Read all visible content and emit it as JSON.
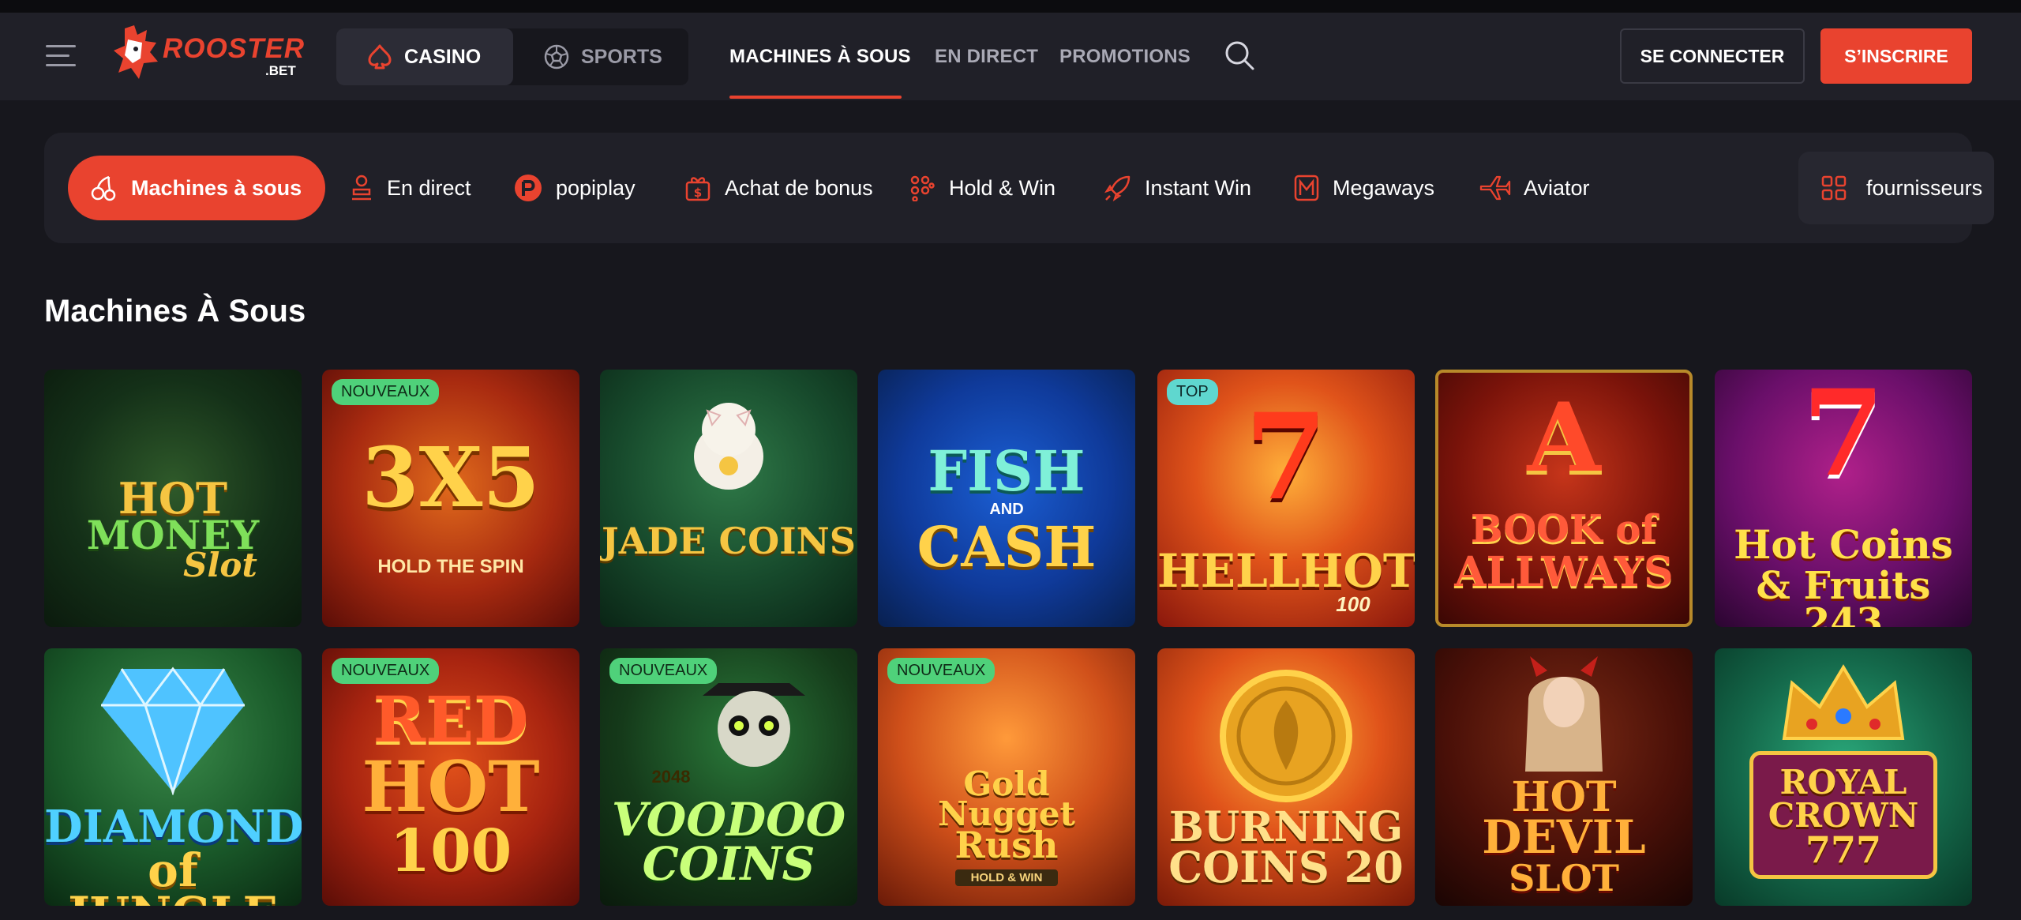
{
  "header": {
    "logo_text": "ROOSTER",
    "logo_sub": ".BET",
    "segments": {
      "casino": "CASINO",
      "sports": "SPORTS"
    },
    "nav": [
      {
        "label": "MACHINES À SOUS",
        "active": true
      },
      {
        "label": "EN DIRECT",
        "active": false
      },
      {
        "label": "PROMOTIONS",
        "active": false
      }
    ],
    "login": "SE CONNECTER",
    "signup": "S’INSCRIRE"
  },
  "categories": [
    {
      "label": "Machines à sous",
      "icon": "cherries-icon",
      "active": true
    },
    {
      "label": "En direct",
      "icon": "dealer-icon",
      "active": false
    },
    {
      "label": "popiplay",
      "icon": "popiplay-icon",
      "active": false
    },
    {
      "label": "Achat de bonus",
      "icon": "gift-dollar-icon",
      "active": false
    },
    {
      "label": "Hold & Win",
      "icon": "dots-grid-icon",
      "active": false
    },
    {
      "label": "Instant Win",
      "icon": "rocket-icon",
      "active": false
    },
    {
      "label": "Megaways",
      "icon": "megaways-icon",
      "active": false
    },
    {
      "label": "Aviator",
      "icon": "plane-icon",
      "active": false
    }
  ],
  "providers_label": "fournisseurs",
  "section_title": "Machines À Sous",
  "games": [
    {
      "name": "Hot Money Slot",
      "line1": "HOT",
      "line2": "MONEY",
      "line3": "Slot",
      "badge": ""
    },
    {
      "name": "3x5 Hold the Spin",
      "line1": "3X5",
      "line2": "HOLD THE SPIN",
      "line3": "",
      "badge": "NOUVEAUX"
    },
    {
      "name": "Jade Coins",
      "line1": "JADE COINS",
      "line2": "",
      "line3": "",
      "badge": ""
    },
    {
      "name": "Fish and Cash",
      "line1": "FISH",
      "line2": "AND",
      "line3": "CASH",
      "badge": ""
    },
    {
      "name": "HellHot 100",
      "line1": "HELLHOT",
      "line2": "100",
      "line3": "",
      "badge": "TOP"
    },
    {
      "name": "Book of Allways",
      "line1": "BOOK of",
      "line2": "ALLWAYS",
      "line3": "",
      "badge": ""
    },
    {
      "name": "Hot Coins & Fruits 243",
      "line1": "Hot Coins",
      "line2": "& Fruits 243",
      "line3": "",
      "badge": ""
    },
    {
      "name": "Diamond of Jungle",
      "line1": "DIAMOND",
      "line2": "of JUNGLE",
      "line3": "",
      "badge": ""
    },
    {
      "name": "Red Hot 100",
      "line1": "RED",
      "line2": "HOT",
      "line3": "100",
      "badge": "NOUVEAUX"
    },
    {
      "name": "Voodoo Coins",
      "line1": "VOODOO",
      "line2": "COINS",
      "line3": "2048",
      "badge": "NOUVEAUX"
    },
    {
      "name": "Gold Nugget Rush",
      "line1": "Gold",
      "line2": "Nugget",
      "line3": "Rush",
      "badge": "NOUVEAUX",
      "extra": "HOLD & WIN"
    },
    {
      "name": "Burning Coins 20",
      "line1": "BURNING",
      "line2": "COINS 20",
      "line3": "",
      "badge": ""
    },
    {
      "name": "Hot Devil Slot",
      "line1": "HOT",
      "line2": "DEVIL",
      "line3": "SLOT",
      "badge": ""
    },
    {
      "name": "Royal Crown 777",
      "line1": "ROYAL",
      "line2": "CROWN",
      "line3": "777",
      "badge": ""
    }
  ],
  "colors": {
    "accent": "#e9432f",
    "bg": "#17171d",
    "panel": "#202028",
    "badge_new": "#4fd17a",
    "badge_top": "#5fd7cf"
  }
}
